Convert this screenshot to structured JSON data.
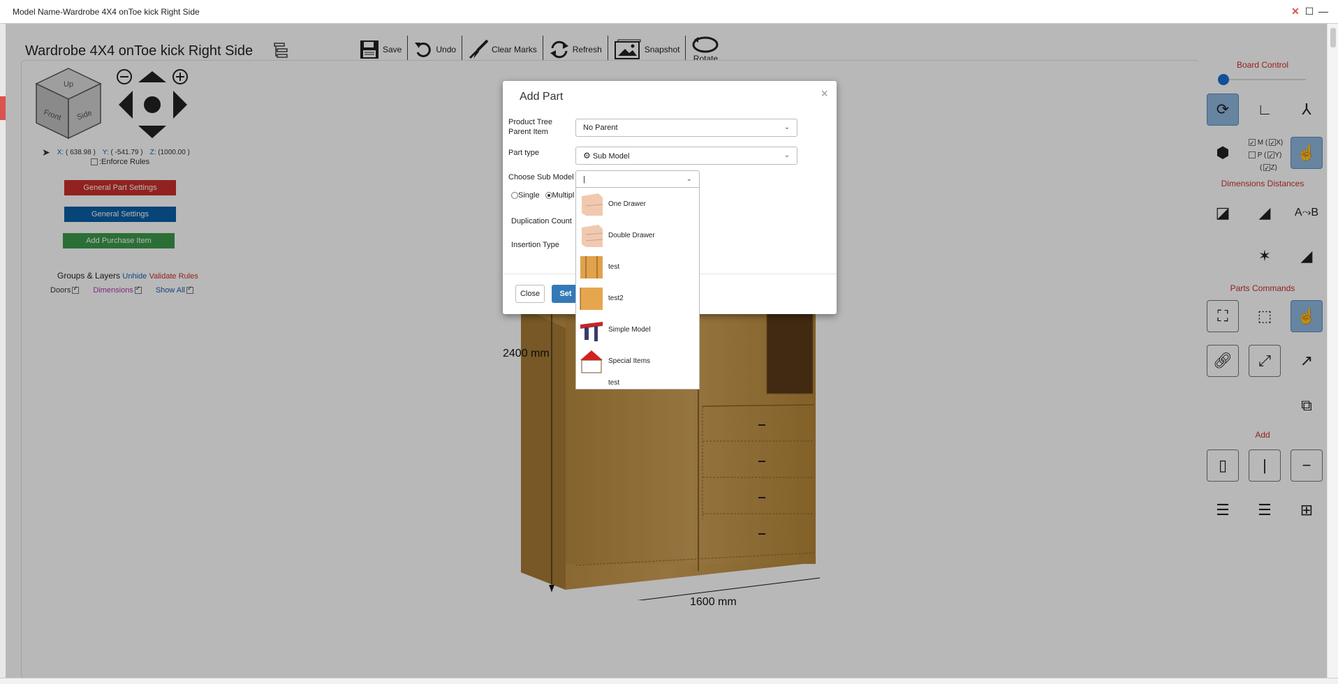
{
  "window": {
    "title": "Model Name-Wardrobe 4X4 onToe kick Right Side"
  },
  "model": {
    "name": "Wardrobe 4X4 onToe kick Right Side"
  },
  "toolbar": {
    "save": "Save",
    "undo": "Undo",
    "clear_marks": "Clear Marks",
    "refresh": "Refresh",
    "snapshot": "Snapshot",
    "rotate": "Rotate"
  },
  "navcube": {
    "up": "Up",
    "front": "Front",
    "side": "Side"
  },
  "coords": {
    "x_label": "X:",
    "x": "( 638.98 )",
    "y_label": "Y:",
    "y": "( -541.79 )",
    "z_label": "Z:",
    "z": "(1000.00 )"
  },
  "enforce": {
    "label": ":Enforce Rules",
    "checked": false
  },
  "left_buttons": {
    "general_part": "General Part Settings",
    "general": "General Settings",
    "add_purchase": "Add Purchase Item"
  },
  "groups": {
    "title": "Groups & Layers",
    "unhide": "Unhide",
    "validate": "Validate Rules"
  },
  "layers": {
    "doors": "Doors",
    "dimensions": "Dimensions",
    "show_all": "Show All"
  },
  "dimensions": {
    "height": "2400 mm",
    "width": "1600 mm"
  },
  "right_panel": {
    "board_control": "Board Control",
    "dimensions_distances": "Dimensions Distances",
    "parts_commands": "Parts Commands",
    "add": "Add",
    "mpz": {
      "m": "M (",
      "x": "X)",
      "p": "P (",
      "y": "Y)",
      "z_open": "(",
      "z": "Z)"
    }
  },
  "dialog": {
    "title": "Add Part",
    "close_x": "×",
    "parent_label": "Product Tree Parent Item",
    "parent_value": "No Parent",
    "part_type_label": "Part type",
    "part_type_value": "Sub Model",
    "choose_label": "Choose Sub Model",
    "choose_value": "|",
    "single": "Single",
    "multiple": "Multipl",
    "dup_label": "Duplication Count",
    "insertion_label": "Insertion Type",
    "close_btn": "Close",
    "set_btn": "Set"
  },
  "dropdown": {
    "items": [
      "One Drawer",
      "Double Drawer",
      "test",
      "test2",
      "Simple Model",
      "Special Items",
      "test"
    ]
  },
  "colors": {
    "accent_red": "#c9302c",
    "accent_blue": "#0b5fa5",
    "accent_green": "#3c9a4c",
    "wood": "#c99a4a"
  }
}
